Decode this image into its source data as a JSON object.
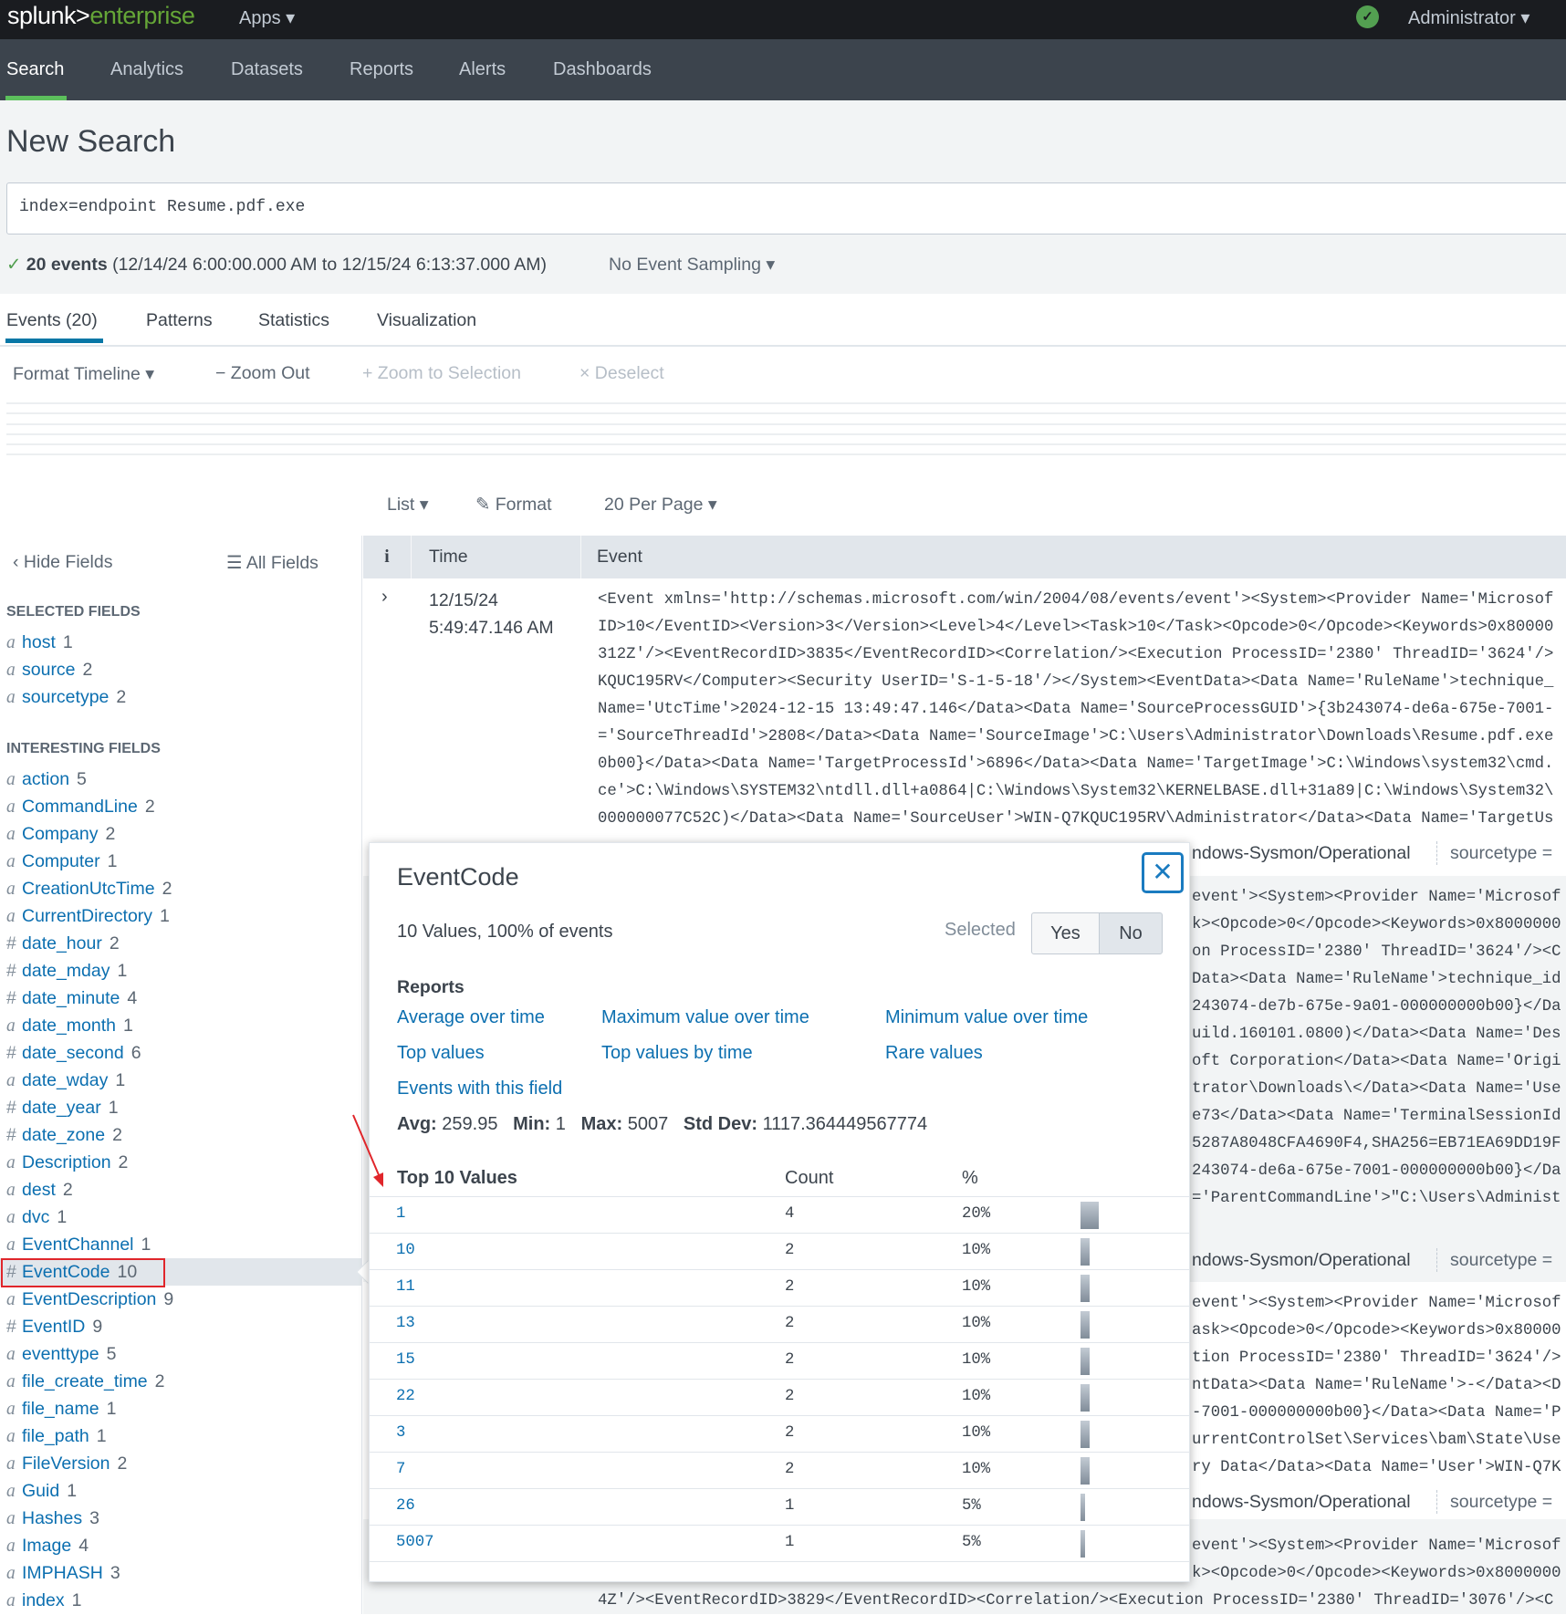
{
  "header": {
    "logo_main": "splunk>",
    "logo_product": "enterprise",
    "apps_label": "Apps ▾",
    "status_icon": "check-circle",
    "user_label": "Administrator ▾"
  },
  "nav": [
    "Search",
    "Analytics",
    "Datasets",
    "Reports",
    "Alerts",
    "Dashboards"
  ],
  "page_title": "New Search",
  "search_query": "index=endpoint Resume.pdf.exe",
  "status": {
    "check": "✓",
    "count": "20 events",
    "range": " (12/14/24 6:00:00.000 AM to 12/15/24 6:13:37.000 AM)",
    "sampling": "No Event Sampling ▾"
  },
  "tabs": [
    "Events (20)",
    "Patterns",
    "Statistics",
    "Visualization"
  ],
  "timeline_toolbar": {
    "format": "Format Timeline ▾",
    "zoom_out": "− Zoom Out",
    "zoom_sel": "+ Zoom to Selection",
    "deselect": "× Deselect"
  },
  "results_toolbar": {
    "list": "List ▾",
    "format": "Format",
    "per_page": "20 Per Page ▾"
  },
  "sidebar": {
    "hide_fields": "‹ Hide Fields",
    "all_fields": "☰ All Fields",
    "selected_heading": "SELECTED FIELDS",
    "interesting_heading": "INTERESTING FIELDS",
    "selected": [
      {
        "type": "a",
        "name": "host",
        "count": "1"
      },
      {
        "type": "a",
        "name": "source",
        "count": "2"
      },
      {
        "type": "a",
        "name": "sourcetype",
        "count": "2"
      }
    ],
    "interesting": [
      {
        "type": "a",
        "name": "action",
        "count": "5"
      },
      {
        "type": "a",
        "name": "CommandLine",
        "count": "2"
      },
      {
        "type": "a",
        "name": "Company",
        "count": "2"
      },
      {
        "type": "a",
        "name": "Computer",
        "count": "1"
      },
      {
        "type": "a",
        "name": "CreationUtcTime",
        "count": "2"
      },
      {
        "type": "a",
        "name": "CurrentDirectory",
        "count": "1"
      },
      {
        "type": "#",
        "name": "date_hour",
        "count": "2"
      },
      {
        "type": "#",
        "name": "date_mday",
        "count": "1"
      },
      {
        "type": "#",
        "name": "date_minute",
        "count": "4"
      },
      {
        "type": "a",
        "name": "date_month",
        "count": "1"
      },
      {
        "type": "#",
        "name": "date_second",
        "count": "6"
      },
      {
        "type": "a",
        "name": "date_wday",
        "count": "1"
      },
      {
        "type": "#",
        "name": "date_year",
        "count": "1"
      },
      {
        "type": "#",
        "name": "date_zone",
        "count": "2"
      },
      {
        "type": "a",
        "name": "Description",
        "count": "2"
      },
      {
        "type": "a",
        "name": "dest",
        "count": "2"
      },
      {
        "type": "a",
        "name": "dvc",
        "count": "1"
      },
      {
        "type": "a",
        "name": "EventChannel",
        "count": "1"
      },
      {
        "type": "#",
        "name": "EventCode",
        "count": "10",
        "highlighted": true
      },
      {
        "type": "a",
        "name": "EventDescription",
        "count": "9"
      },
      {
        "type": "#",
        "name": "EventID",
        "count": "9"
      },
      {
        "type": "a",
        "name": "eventtype",
        "count": "5"
      },
      {
        "type": "a",
        "name": "file_create_time",
        "count": "2"
      },
      {
        "type": "a",
        "name": "file_name",
        "count": "1"
      },
      {
        "type": "a",
        "name": "file_path",
        "count": "1"
      },
      {
        "type": "a",
        "name": "FileVersion",
        "count": "2"
      },
      {
        "type": "a",
        "name": "Guid",
        "count": "1"
      },
      {
        "type": "a",
        "name": "Hashes",
        "count": "3"
      },
      {
        "type": "a",
        "name": "Image",
        "count": "4"
      },
      {
        "type": "a",
        "name": "IMPHASH",
        "count": "3"
      },
      {
        "type": "a",
        "name": "index",
        "count": "1"
      }
    ]
  },
  "table": {
    "headers": {
      "info": "i",
      "time": "Time",
      "event": "Event"
    },
    "events": [
      {
        "time_date": "12/15/24",
        "time_clock": "5:49:47.146 AM",
        "lines": [
          "<Event xmlns='http://schemas.microsoft.com/win/2004/08/events/event'><System><Provider Name='Microsof",
          "ID>10</EventID><Version>3</Version><Level>4</Level><Task>10</Task><Opcode>0</Opcode><Keywords>0x80000",
          "312Z'/><EventRecordID>3835</EventRecordID><Correlation/><Execution ProcessID='2380' ThreadID='3624'/>",
          "KQUC195RV</Computer><Security UserID='S-1-5-18'/></System><EventData><Data Name='RuleName'>technique_",
          "Name='UtcTime'>2024-12-15 13:49:47.146</Data><Data Name='SourceProcessGUID'>{3b243074-de6a-675e-7001-",
          "='SourceThreadId'>2808</Data><Data Name='SourceImage'>C:\\Users\\Administrator\\Downloads\\Resume.pdf.exe",
          "0b00}</Data><Data Name='TargetProcessId'>6896</Data><Data Name='TargetImage'>C:\\Windows\\system32\\cmd.",
          "ce'>C:\\Windows\\SYSTEM32\\ntdll.dll+a0864|C:\\Windows\\System32\\KERNELBASE.dll+31a89|C:\\Windows\\System32\\",
          "000000077C52C)</Data><Data Name='SourceUser'>WIN-Q7KQUC195RV\\Administrator</Data><Data Name='TargetUs"
        ],
        "field_source": "ndows-Sysmon/Operational",
        "field_sourcetype": "sourcetype ="
      },
      {
        "lines": [
          "event'><System><Provider Name='Microsof",
          "k><Opcode>0</Opcode><Keywords>0x8000000",
          "on ProcessID='2380' ThreadID='3624'/><C",
          "Data><Data Name='RuleName'>technique_id",
          "243074-de7b-675e-9a01-000000000b00}</Da",
          "uild.160101.0800)</Data><Data Name='Des",
          "oft Corporation</Data><Data Name='Origi",
          "trator\\Downloads\\</Data><Data Name='Use",
          "e73</Data><Data Name='TerminalSessionId",
          "5287A8048CFA4690F4,SHA256=EB71EA69DD19F",
          "243074-de6a-675e-7001-000000000b00}</Da",
          "='ParentCommandLine'>\"C:\\Users\\Administ"
        ],
        "field_source": "ndows-Sysmon/Operational",
        "field_sourcetype": "sourcetype ="
      },
      {
        "lines": [
          "event'><System><Provider Name='Microsof",
          "ask><Opcode>0</Opcode><Keywords>0x80000",
          "tion ProcessID='2380' ThreadID='3624'/>",
          "ntData><Data Name='RuleName'>-</Data><D",
          "-7001-000000000b00}</Data><Data Name='P",
          "urrentControlSet\\Services\\bam\\State\\Use",
          "ry Data</Data><Data Name='User'>WIN-Q7K"
        ],
        "field_source": "ndows-Sysmon/Operational",
        "field_sourcetype": "sourcetype ="
      },
      {
        "lines": [
          "event'><System><Provider Name='Microsof",
          "k><Opcode>0</Opcode><Keywords>0x8000000",
          "4Z'/><EventRecordID>3829</EventRecordID><Correlation/><Execution ProcessID='2380' ThreadID='3076'/><C"
        ]
      }
    ]
  },
  "popup": {
    "title": "EventCode",
    "summary": "10 Values, 100% of events",
    "selected_label": "Selected",
    "yes": "Yes",
    "no": "No",
    "selected_value": "No",
    "reports_heading": "Reports",
    "reports": [
      "Average over time",
      "Maximum value over time",
      "Minimum value over time",
      "Top values",
      "Top values by time",
      "Rare values",
      "Events with this field"
    ],
    "stats": {
      "avg_label": "Avg:",
      "avg": "259.95",
      "min_label": "Min:",
      "min": "1",
      "max_label": "Max:",
      "max": "5007",
      "std_label": "Std Dev:",
      "std": "1117.364449567774"
    },
    "columns": {
      "value": "Top 10 Values",
      "count": "Count",
      "pct": "%"
    },
    "values": [
      {
        "value": "1",
        "count": "4",
        "pct": "20%",
        "fraction": 0.2
      },
      {
        "value": "10",
        "count": "2",
        "pct": "10%",
        "fraction": 0.1
      },
      {
        "value": "11",
        "count": "2",
        "pct": "10%",
        "fraction": 0.1
      },
      {
        "value": "13",
        "count": "2",
        "pct": "10%",
        "fraction": 0.1
      },
      {
        "value": "15",
        "count": "2",
        "pct": "10%",
        "fraction": 0.1
      },
      {
        "value": "22",
        "count": "2",
        "pct": "10%",
        "fraction": 0.1
      },
      {
        "value": "3",
        "count": "2",
        "pct": "10%",
        "fraction": 0.1
      },
      {
        "value": "7",
        "count": "2",
        "pct": "10%",
        "fraction": 0.1
      },
      {
        "value": "26",
        "count": "1",
        "pct": "5%",
        "fraction": 0.05
      },
      {
        "value": "5007",
        "count": "1",
        "pct": "5%",
        "fraction": 0.05
      }
    ]
  },
  "colors": {
    "accent_green": "#5cc05c",
    "tab_blue": "#0877a6",
    "link": "#0c6fb0",
    "annotation_red": "#e0262b"
  }
}
